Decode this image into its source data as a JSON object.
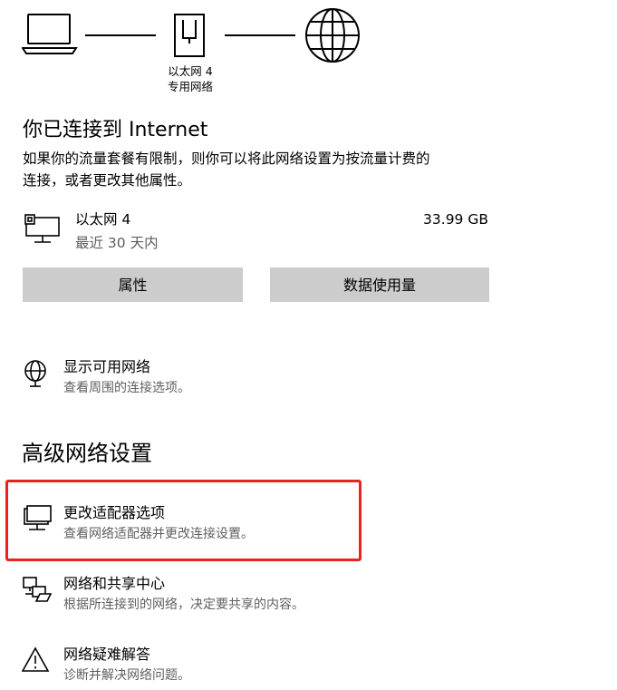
{
  "diagram": {
    "adapter_name": "以太网 4",
    "network_type": "专用网络"
  },
  "status": {
    "title": "你已连接到 Internet",
    "description_line1": "如果你的流量套餐有限制，则你可以将此网络设置为按流量计费的",
    "description_line2": "连接，或者更改其他属性。"
  },
  "connection": {
    "name": "以太网 4",
    "period": "最近 30 天内",
    "usage": "33.99 GB",
    "properties_button": "属性",
    "data_usage_button": "数据使用量"
  },
  "show_networks": {
    "title": "显示可用网络",
    "subtitle": "查看周围的连接选项。"
  },
  "advanced": {
    "heading": "高级网络设置",
    "items": [
      {
        "title": "更改适配器选项",
        "subtitle": "查看网络适配器并更改连接设置。"
      },
      {
        "title": "网络和共享中心",
        "subtitle": "根据所连接到的网络，决定要共享的内容。"
      },
      {
        "title": "网络疑难解答",
        "subtitle": "诊断并解决网络问题。"
      }
    ]
  },
  "colors": {
    "highlight": "#e8231f",
    "button_bg": "#cccccc",
    "secondary_text": "#5f5f5f"
  },
  "icons": [
    "laptop-icon",
    "ethernet-port-icon",
    "globe-icon",
    "ethernet-pc-icon",
    "globe-antenna-icon",
    "adapter-icon",
    "sharing-center-icon",
    "warning-icon"
  ]
}
